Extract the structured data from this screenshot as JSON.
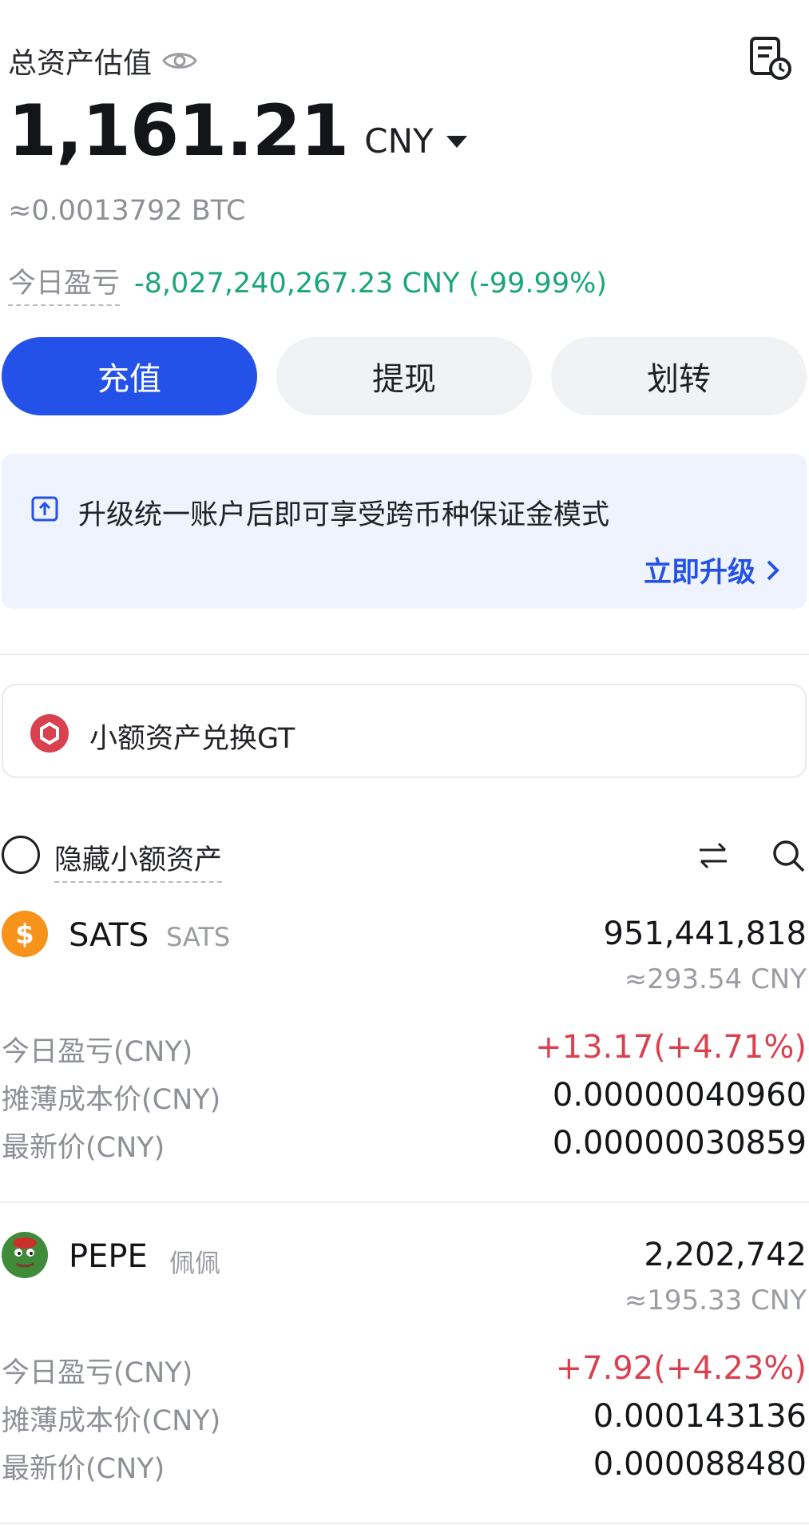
{
  "header": {
    "title": "总资产估值",
    "eye_icon": "eye-icon",
    "history_icon": "order-history-icon"
  },
  "balance": {
    "amount": "1,161.21",
    "currency": "CNY",
    "btc_equiv": "≈0.0013792 BTC"
  },
  "today_pnl": {
    "label": "今日盈亏",
    "value": "-8,027,240,267.23 CNY (-99.99%)"
  },
  "actions": {
    "deposit": "充值",
    "withdraw": "提现",
    "transfer": "划转"
  },
  "upgrade_banner": {
    "text": "升级统一账户后即可享受跨币种保证金模式",
    "link": "立即升级"
  },
  "small_asset": {
    "label": "小额资产兑换GT"
  },
  "list_toolbar": {
    "hide_small": "隐藏小额资产"
  },
  "assets": [
    {
      "symbol": "SATS",
      "name": "SATS",
      "quantity": "951,441,818",
      "cny_value": "≈293.54 CNY",
      "pnl_label": "今日盈亏(CNY)",
      "pnl_value": "+13.17(+4.71%)",
      "cost_label": "摊薄成本价(CNY)",
      "cost_value": "0.00000040960",
      "price_label": "最新价(CNY)",
      "price_value": "0.00000030859"
    },
    {
      "symbol": "PEPE",
      "name": "佩佩",
      "quantity": "2,202,742",
      "cny_value": "≈195.33 CNY",
      "pnl_label": "今日盈亏(CNY)",
      "pnl_value": "+7.92(+4.23%)",
      "cost_label": "摊薄成本价(CNY)",
      "cost_value": "0.000143136",
      "price_label": "最新价(CNY)",
      "price_value": "0.000088480"
    }
  ],
  "colors": {
    "primary": "#2452e8",
    "positive": "#1aa67a",
    "negative": "#d9414f",
    "muted": "#8e9097"
  }
}
